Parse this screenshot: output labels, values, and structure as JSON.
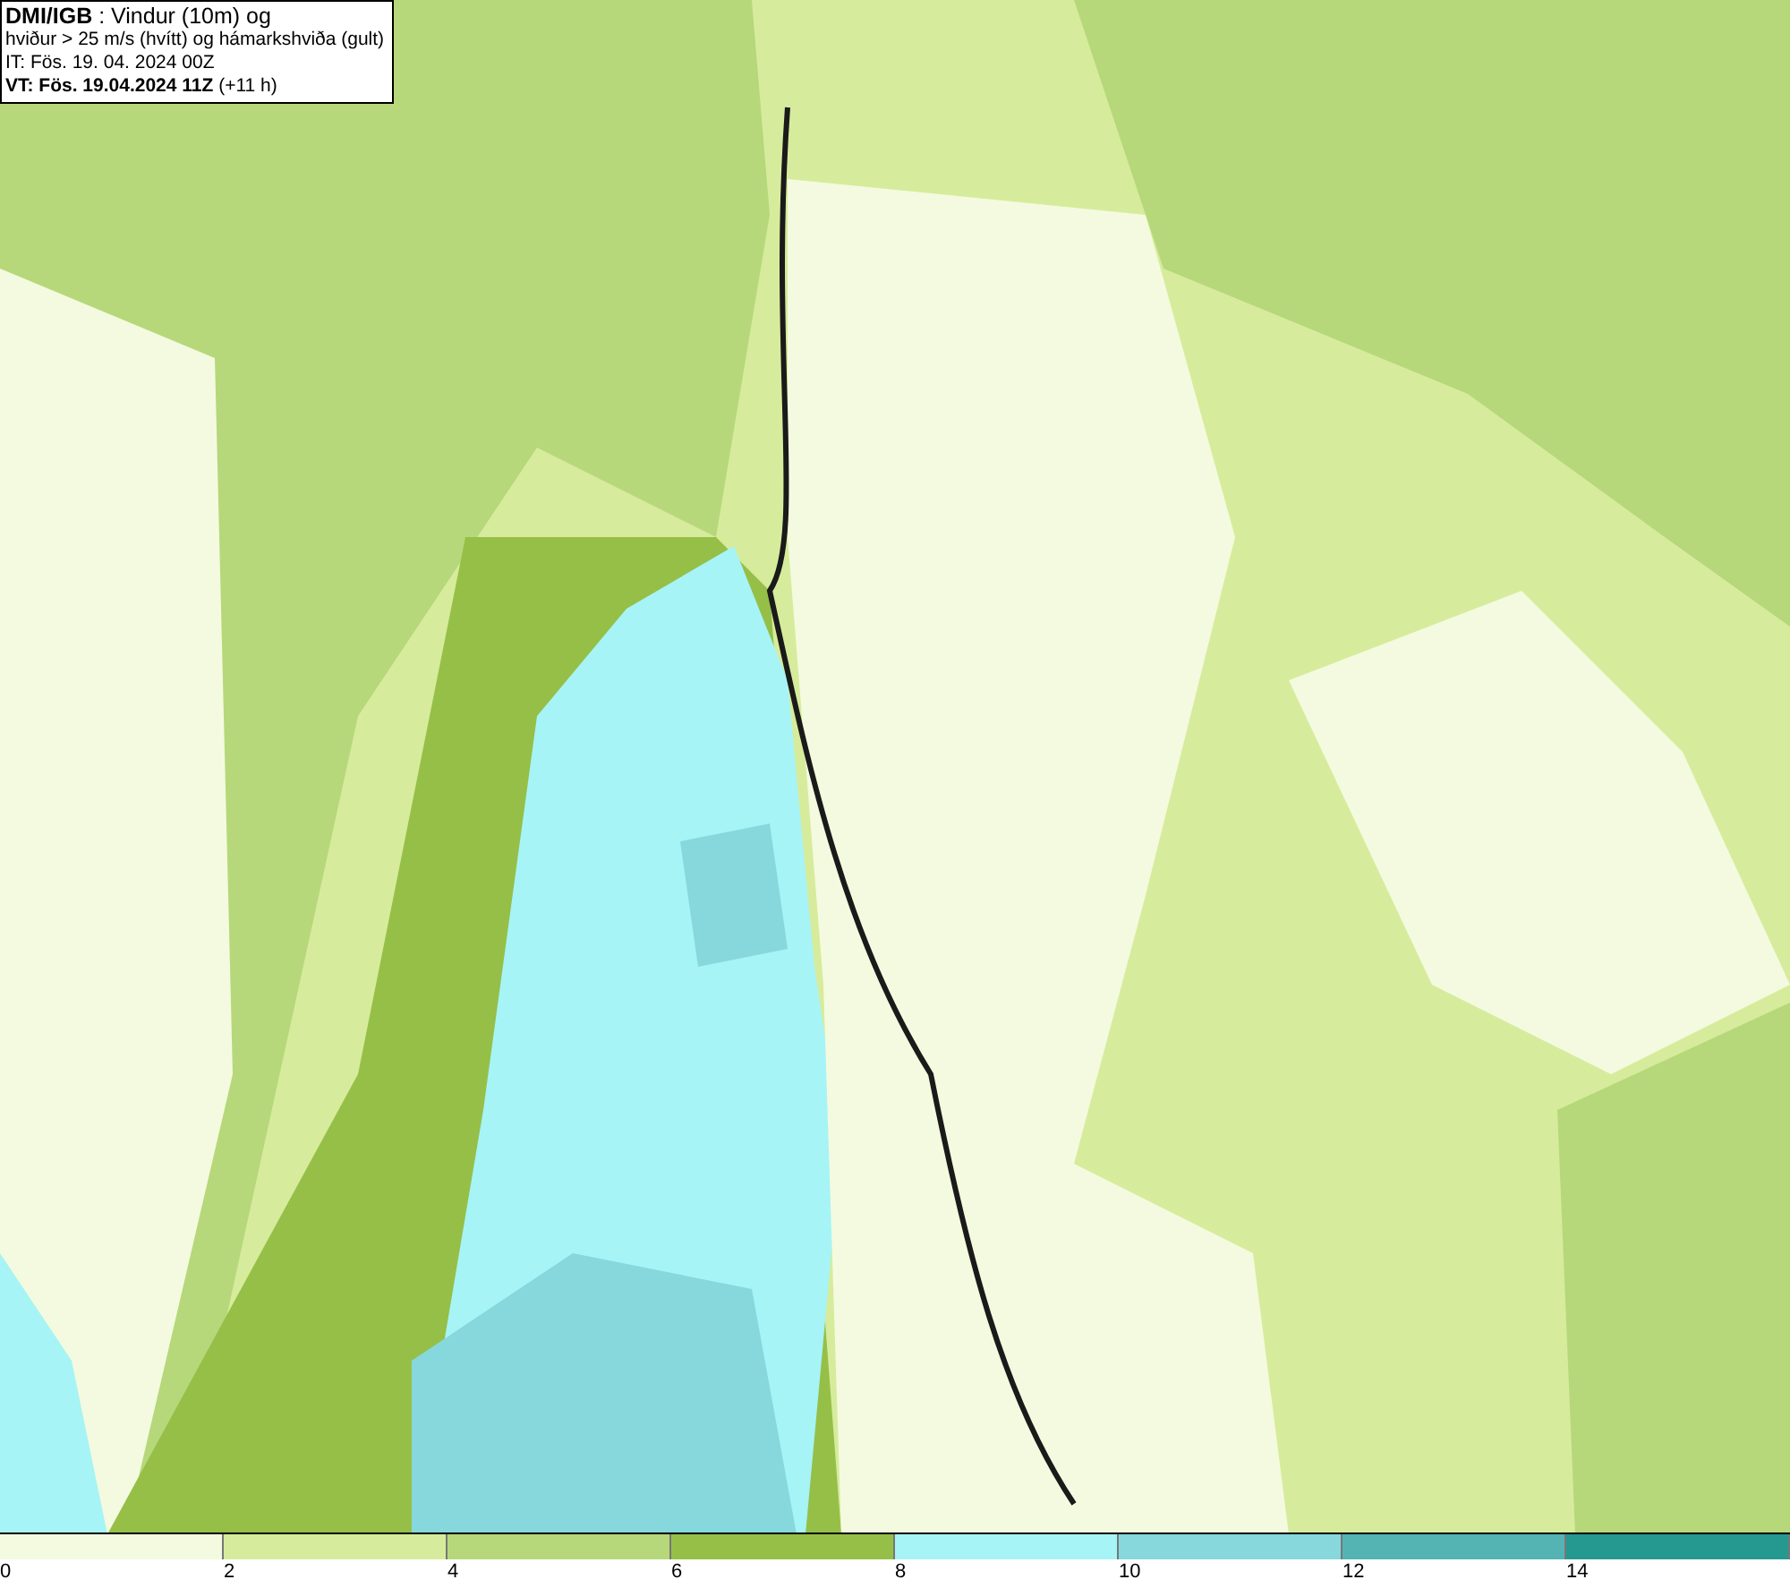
{
  "header": {
    "lines": [
      "**DMI/IGB** : Vindur (10m) og",
      "hviður > 25 m/s (hvítt) og hámarkshviða (gult)",
      "IT: Fös. 19. 04. 2024 00Z",
      "**VT: Fös. 19.04.2024 11Z** (+11 h)"
    ]
  },
  "legend": {
    "bins": [
      {
        "label": "0",
        "color": "#f4fadf"
      },
      {
        "label": "2",
        "color": "#d6ec9c"
      },
      {
        "label": "4",
        "color": "#b6d87a"
      },
      {
        "label": "6",
        "color": "#96bf48"
      },
      {
        "label": "8",
        "color": "#a6f4f6"
      },
      {
        "label": "10",
        "color": "#86d8dc"
      },
      {
        "label": "12",
        "color": "#54b4b4"
      },
      {
        "label": "14",
        "color": "#259890"
      }
    ]
  }
}
